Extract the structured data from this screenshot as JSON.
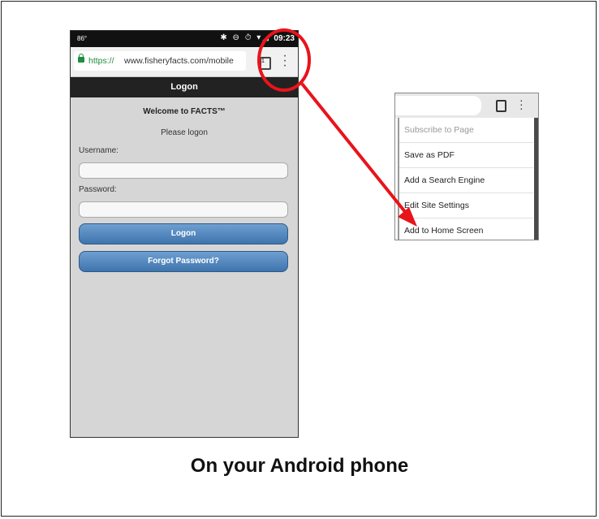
{
  "phone": {
    "status_bar": {
      "temperature": "86°",
      "icons": "✱ ⊖ ⏱ ▾◢",
      "time": "09:23"
    },
    "browser": {
      "url_scheme": "https://",
      "url_rest": "www.fisheryfacts.com/mobile",
      "tab_count": "1",
      "menu_icon": "three-dots-vertical-icon"
    },
    "app": {
      "header_title": "Logon",
      "welcome": "Welcome to FACTS™",
      "subtitle": "Please logon",
      "username_label": "Username:",
      "password_label": "Password:",
      "username_value": "",
      "password_value": "",
      "logon_button": "Logon",
      "forgot_button": "Forgot Password?"
    }
  },
  "menu_crop": {
    "items": [
      {
        "label": "Subscribe to Page",
        "enabled": false
      },
      {
        "label": "Save as PDF",
        "enabled": true
      },
      {
        "label": "Add a Search Engine",
        "enabled": true
      },
      {
        "label": "Edit Site Settings",
        "enabled": true
      },
      {
        "label": "Add to Home Screen",
        "enabled": true
      }
    ]
  },
  "annotation": {
    "color": "#e8141b"
  },
  "caption": "On your Android phone"
}
